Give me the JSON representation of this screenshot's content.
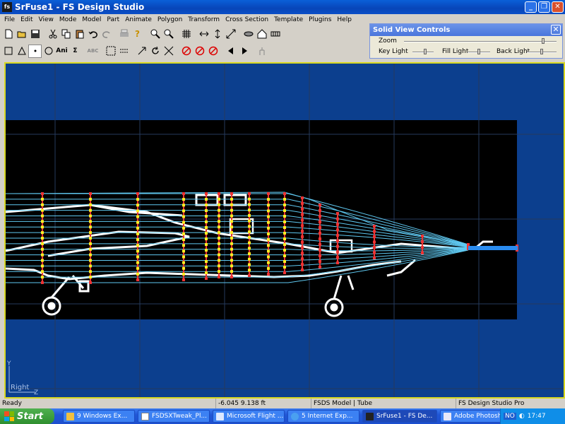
{
  "window": {
    "title": "SrFuse1 - FS Design Studio",
    "icon_text": "fs"
  },
  "menu": [
    "File",
    "Edit",
    "View",
    "Mode",
    "Model",
    "Part",
    "Animate",
    "Polygon",
    "Transform",
    "Cross Section",
    "Template",
    "Plugins",
    "Help"
  ],
  "toolbar1": [
    "new-icon",
    "open-icon",
    "save-icon",
    "cut-icon",
    "copy-icon",
    "paste-icon",
    "undo-icon",
    "redo-icon",
    "print-icon",
    "help-icon",
    "zoom-in-icon",
    "zoom-out-icon",
    "grid-icon",
    "align-x-icon",
    "align-y-icon",
    "align-z-icon",
    "view-solid-icon",
    "view-home-icon",
    "view-wire-icon"
  ],
  "toolbar2": {
    "ani_label": "Ani",
    "sigma_label": "Σ",
    "abc_label": "ABC"
  },
  "solid_view_controls": {
    "title": "Solid View Controls",
    "zoom_label": "Zoom",
    "key_light_label": "Key Light",
    "fill_light_label": "Fill Light",
    "back_light_label": "Back Light",
    "zoom_level": 0.92,
    "key_light_level": 0.6,
    "fill_light_level": 0.5,
    "back_light_level": 0.5
  },
  "viewport": {
    "axis_y": "Y",
    "axis_z": "Z",
    "view_label": "Right",
    "background": "#0c3f8e",
    "frame_color": "#d8d820",
    "wire_color": "#5fc8f0"
  },
  "statusbar": {
    "ready": "Ready",
    "coords": "-6.045    9.138 ft",
    "model_info": "FSDS Model | Tube",
    "product": "FS Design Studio Pro"
  },
  "taskbar": {
    "start_label": "Start",
    "tasks": [
      {
        "label": "9 Windows Ex...",
        "icon": "folder-icon"
      },
      {
        "label": "FSDSXTweak_Pl...",
        "icon": "document-icon"
      },
      {
        "label": "Microsoft Flight ...",
        "icon": "plane-icon"
      },
      {
        "label": "5 Internet Exp...",
        "icon": "ie-icon"
      },
      {
        "label": "SrFuse1 - FS De...",
        "icon": "fsds-icon"
      },
      {
        "label": "Adobe Photoshop",
        "icon": "photoshop-icon"
      }
    ],
    "lang": "NO",
    "clock": "17:47"
  }
}
